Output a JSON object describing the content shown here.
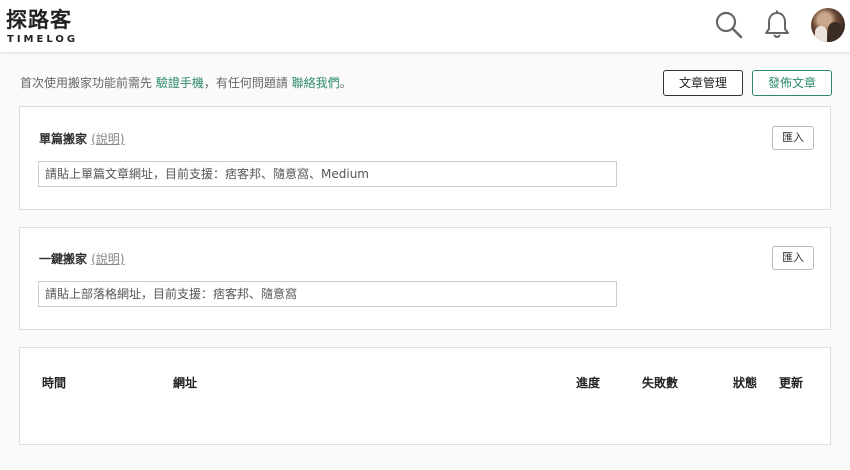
{
  "header": {
    "logo_main": "探路客",
    "logo_sub": "TIMELOG",
    "search_icon": "search-icon",
    "bell_icon": "bell-icon"
  },
  "notice": {
    "prefix": "首次使用搬家功能前需先 ",
    "verify_link": "驗證手機",
    "middle": "，有任何問題請 ",
    "contact_link": "聯絡我們",
    "suffix": "。"
  },
  "toolbar": {
    "manage_label": "文章管理",
    "publish_label": "發佈文章"
  },
  "single": {
    "title": "單篇搬家",
    "explain": "(說明)",
    "placeholder": "請貼上單篇文章網址，目前支援：痞客邦、隨意窩、Medium",
    "import_label": "匯入"
  },
  "bulk": {
    "title": "一鍵搬家",
    "explain": "(說明)",
    "placeholder": "請貼上部落格網址，目前支援：痞客邦、隨意窩",
    "import_label": "匯入"
  },
  "table": {
    "columns": [
      "時間",
      "網址",
      "進度",
      "失敗數",
      "狀態",
      "更新"
    ]
  },
  "colors": {
    "accent_green": "#2e8b67"
  }
}
